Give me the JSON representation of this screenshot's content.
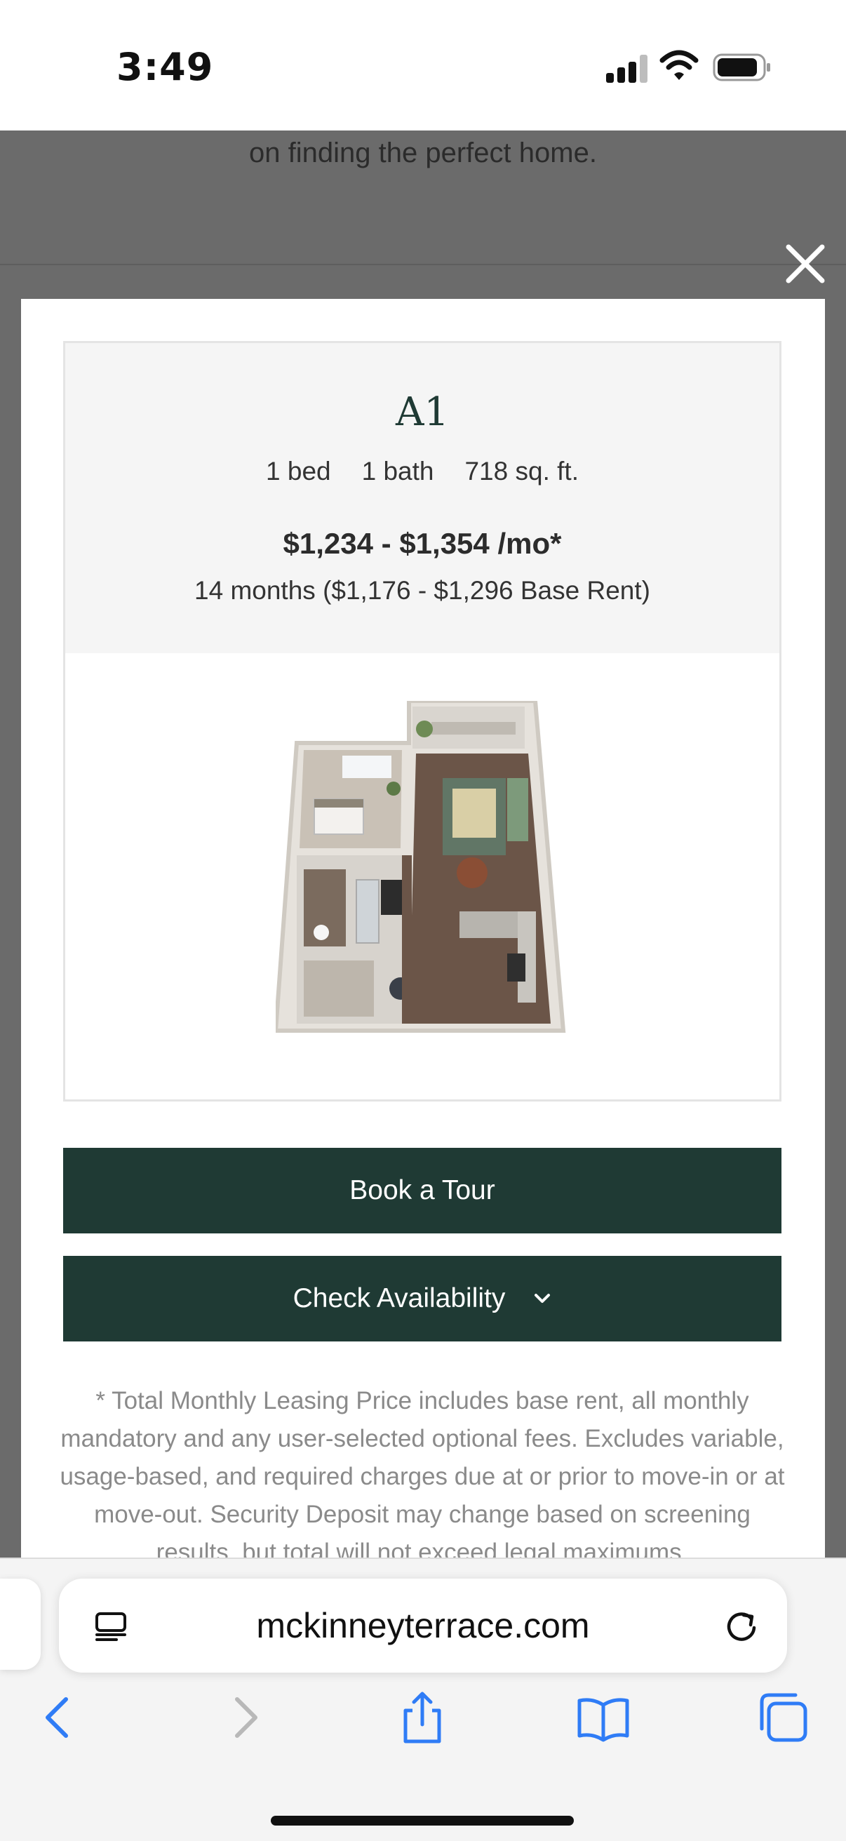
{
  "status_bar": {
    "time": "3:49"
  },
  "background_page": {
    "text": "on finding the perfect home."
  },
  "modal": {
    "plan_name": "A1",
    "beds": "1 bed",
    "baths": "1 bath",
    "size": "718 sq. ft.",
    "price": "$1,234 - $1,354 /mo*",
    "term": "14 months ($1,176 - $1,296 Base Rent)",
    "book_tour_label": "Book a Tour",
    "check_availability_label": "Check Availability",
    "disclaimer": "* Total Monthly Leasing Price includes base rent, all monthly mandatory and any user-selected optional fees. Excludes variable, usage-based, and required charges due at or prior to move-in or at move-out. Security Deposit may change based on screening results, but total will not exceed legal maximums."
  },
  "browser": {
    "url": "mckinneyterrace.com",
    "accent_color": "#2f7cf6"
  },
  "colors": {
    "brand_dark_green": "#1f3a34",
    "overlay_gray": "#6b6b6b"
  }
}
